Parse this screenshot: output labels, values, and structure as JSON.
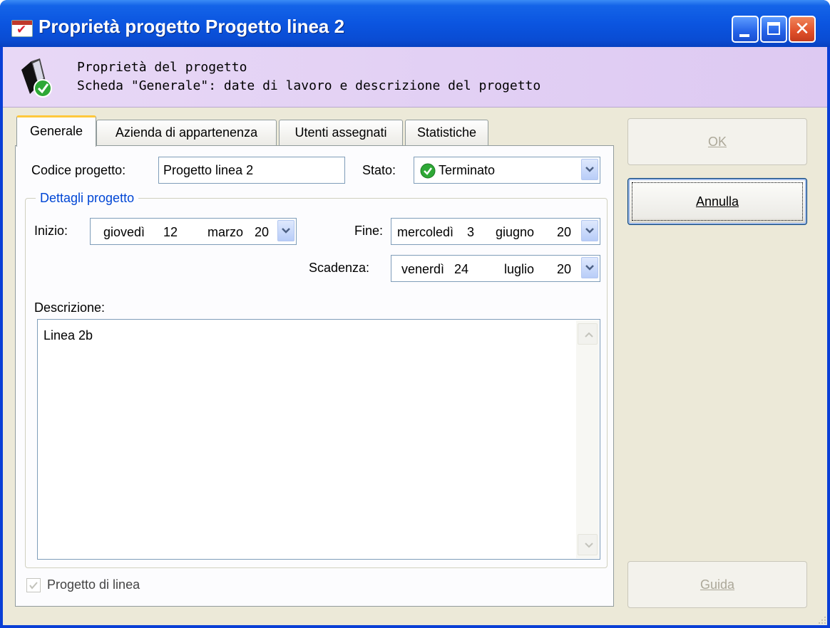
{
  "window": {
    "title": "Proprietà progetto Progetto linea 2"
  },
  "header": {
    "line1": "Proprietà del progetto",
    "line2": "Scheda \"Generale\": date di lavoro e descrizione del progetto"
  },
  "tabs": [
    {
      "label": "Generale",
      "active": true
    },
    {
      "label": "Azienda di appartenenza",
      "active": false
    },
    {
      "label": "Utenti assegnati",
      "active": false
    },
    {
      "label": "Statistiche",
      "active": false
    }
  ],
  "form": {
    "codice_label": "Codice progetto:",
    "codice_value": "Progetto linea 2",
    "stato_label": "Stato:",
    "stato_value": "Terminato",
    "group_title": "Dettagli progetto",
    "inizio_label": "Inizio:",
    "inizio": {
      "weekday": "giovedì",
      "day": "12",
      "month": "marzo",
      "year": "20"
    },
    "fine_label": "Fine:",
    "fine": {
      "weekday": "mercoledì",
      "day": "3",
      "month": "giugno",
      "year": "20"
    },
    "scadenza_label": "Scadenza:",
    "scadenza": {
      "weekday": "venerdì",
      "day": "24",
      "month": "luglio",
      "year": "20"
    },
    "descrizione_label": "Descrizione:",
    "descrizione_value": "Linea 2b",
    "linea_label": "Progetto di linea",
    "linea_checked": true
  },
  "buttons": {
    "ok": "OK",
    "annulla": "Annulla",
    "guida": "Guida"
  },
  "colors": {
    "titlebar": "#0a4cd3",
    "header_bg": "#e5d6f5",
    "group_title": "#0046d5",
    "status_green": "#2ea836"
  }
}
